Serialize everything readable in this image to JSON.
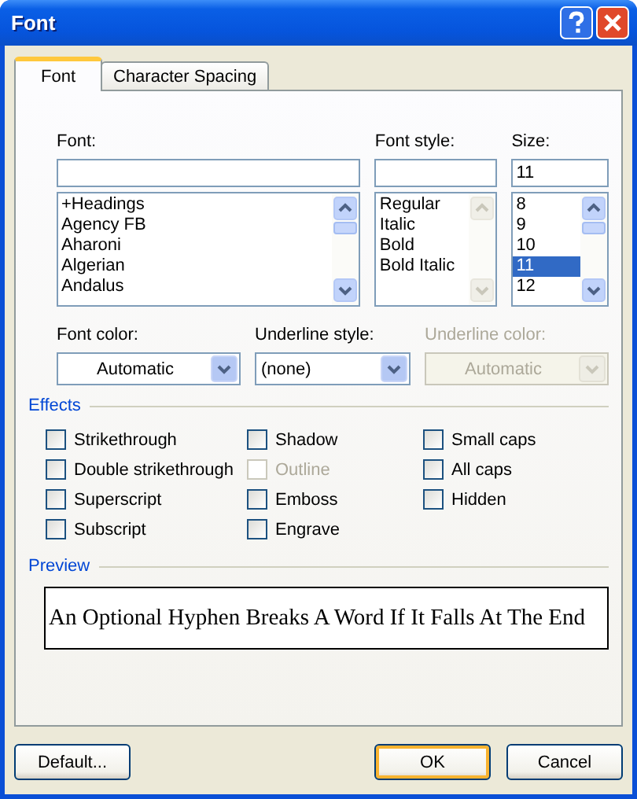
{
  "window": {
    "title": "Font"
  },
  "tabs": [
    {
      "label": "Font",
      "selected": true
    },
    {
      "label": "Character Spacing",
      "selected": false
    }
  ],
  "font": {
    "label": "Font:",
    "items": [
      {
        "label": "+Headings",
        "selected": false
      },
      {
        "label": "Agency FB",
        "selected": false
      },
      {
        "label": "Aharoni",
        "selected": false
      },
      {
        "label": "Algerian",
        "selected": false
      },
      {
        "label": "Andalus",
        "selected": false
      }
    ],
    "scroll_enabled": true
  },
  "font_style": {
    "label": "Font style:",
    "items": [
      {
        "label": "Regular",
        "selected": false
      },
      {
        "label": "Italic",
        "selected": false
      },
      {
        "label": "Bold",
        "selected": false
      },
      {
        "label": "Bold Italic",
        "selected": false
      }
    ],
    "scroll_enabled": false
  },
  "size": {
    "label": "Size:",
    "value": "11",
    "items": [
      {
        "label": "8",
        "selected": false
      },
      {
        "label": "9",
        "selected": false
      },
      {
        "label": "10",
        "selected": false
      },
      {
        "label": "11",
        "selected": true
      },
      {
        "label": "12",
        "selected": false
      }
    ],
    "scroll_enabled": true
  },
  "dropdowns": [
    {
      "label": "Font color:",
      "value": "Automatic",
      "disabled": false
    },
    {
      "label": "Underline style:",
      "value": "(none)",
      "disabled": false
    },
    {
      "label": "Underline color:",
      "value": "Automatic",
      "disabled": true
    }
  ],
  "effects": {
    "title": "Effects",
    "columns": [
      [
        {
          "label": "Strikethrough",
          "checked": false,
          "disabled": false
        },
        {
          "label": "Double strikethrough",
          "checked": false,
          "disabled": false
        },
        {
          "label": "Superscript",
          "checked": false,
          "disabled": false
        },
        {
          "label": "Subscript",
          "checked": false,
          "disabled": false
        }
      ],
      [
        {
          "label": "Shadow",
          "checked": false,
          "disabled": false
        },
        {
          "label": "Outline",
          "checked": false,
          "disabled": true
        },
        {
          "label": "Emboss",
          "checked": false,
          "disabled": false
        },
        {
          "label": "Engrave",
          "checked": false,
          "disabled": false
        }
      ],
      [
        {
          "label": "Small caps",
          "checked": false,
          "disabled": false
        },
        {
          "label": "All caps",
          "checked": false,
          "disabled": false
        },
        {
          "label": "Hidden",
          "checked": false,
          "disabled": false
        }
      ]
    ]
  },
  "preview": {
    "title": "Preview",
    "text": "An Optional Hyphen Breaks A Word If It Falls At The End"
  },
  "buttons": [
    {
      "label": "Default...",
      "default": false
    },
    {
      "label": "OK",
      "default": true
    },
    {
      "label": "Cancel",
      "default": false
    }
  ]
}
